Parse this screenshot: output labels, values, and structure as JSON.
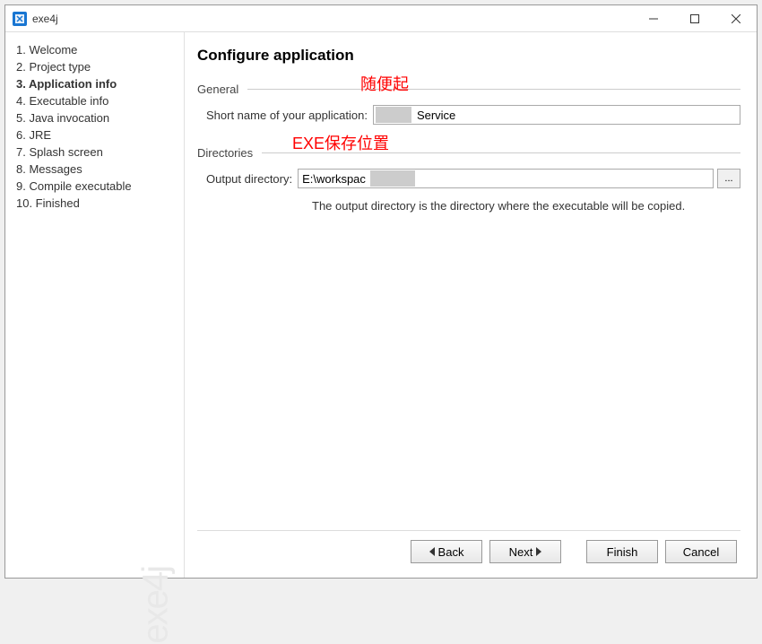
{
  "window": {
    "title": "exe4j"
  },
  "sidebar": {
    "steps": [
      {
        "label": "1. Welcome"
      },
      {
        "label": "2. Project type"
      },
      {
        "label": "3. Application info",
        "active": true
      },
      {
        "label": "4. Executable info"
      },
      {
        "label": "5. Java invocation"
      },
      {
        "label": "6. JRE"
      },
      {
        "label": "7. Splash screen"
      },
      {
        "label": "8. Messages"
      },
      {
        "label": "9. Compile executable"
      },
      {
        "label": "10. Finished"
      }
    ],
    "brand": "exe4j"
  },
  "main": {
    "title": "Configure application",
    "general": {
      "section_label": "General",
      "short_name_label": "Short name of your application:",
      "short_name_value": "Service",
      "annotation": "随便起"
    },
    "directories": {
      "section_label": "Directories",
      "output_label": "Output directory:",
      "output_value": "E:\\workspac",
      "browse_label": "...",
      "hint": "The output directory is the directory where the executable will be copied.",
      "annotation": "EXE保存位置"
    }
  },
  "buttons": {
    "back": "Back",
    "next": "Next",
    "finish": "Finish",
    "cancel": "Cancel"
  }
}
